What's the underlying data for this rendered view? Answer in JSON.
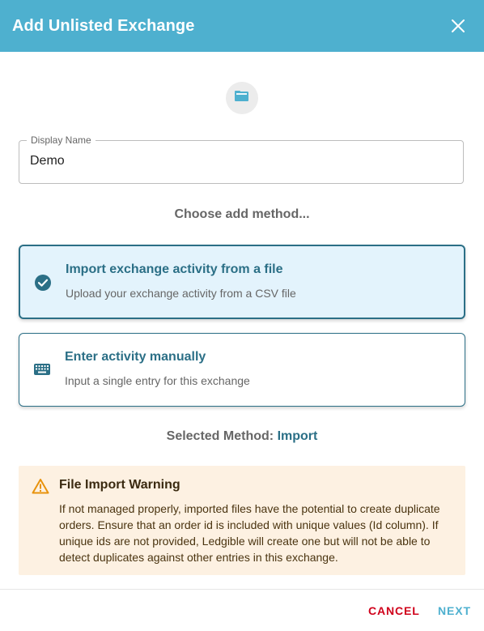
{
  "dialog": {
    "title": "Add Unlisted Exchange",
    "close_icon": "close-icon",
    "folder_icon": "folder-icon"
  },
  "display_name": {
    "label": "Display Name",
    "value": "Demo"
  },
  "choose_label": "Choose add method...",
  "methods": [
    {
      "icon": "check-circle-icon",
      "title": "Import exchange activity from a file",
      "subtitle": "Upload your exchange activity from a CSV file",
      "selected": true
    },
    {
      "icon": "keyboard-icon",
      "title": "Enter activity manually",
      "subtitle": "Input a single entry for this exchange",
      "selected": false
    }
  ],
  "selected_method": {
    "label": "Selected Method:",
    "value": "Import"
  },
  "warning": {
    "icon": "warning-triangle-icon",
    "title": "File Import Warning",
    "text": "If not managed properly, imported files have the potential to create duplicate orders. Ensure that an order id is included with unique values (Id column). If unique ids are not provided, Ledgible will create one but will not be able to detect duplicates against other entries in this exchange."
  },
  "footer": {
    "cancel_label": "CANCEL",
    "next_label": "NEXT"
  },
  "colors": {
    "header": "#4eb0cf",
    "accent": "#2b6f86",
    "selected_card_bg": "#e3f3fc",
    "warning_bg": "#fdf1e2",
    "warning_icon": "#e8920c",
    "cancel": "#d0021b",
    "next": "#4eb0cf"
  }
}
